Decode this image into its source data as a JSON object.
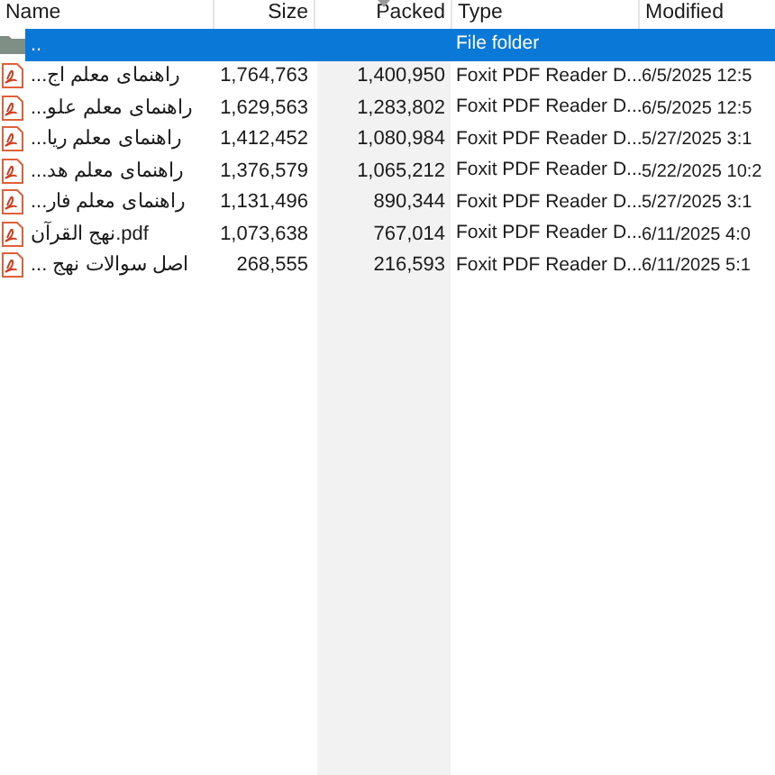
{
  "columns": [
    {
      "label": "Name",
      "sorted": false
    },
    {
      "label": "Size",
      "sorted": false
    },
    {
      "label": "Packed",
      "sorted": true
    },
    {
      "label": "Type",
      "sorted": false
    },
    {
      "label": "Modified",
      "sorted": false
    }
  ],
  "rows": [
    {
      "kind": "folder",
      "selected": true,
      "name": "..",
      "size": "",
      "packed": "",
      "type": "File folder",
      "modified": ""
    },
    {
      "kind": "pdf",
      "selected": false,
      "name": "...راهنمای معلم اج",
      "size": "1,764,763",
      "packed": "1,400,950",
      "type": "Foxit PDF Reader D...",
      "modified": "6/5/2025 12:5"
    },
    {
      "kind": "pdf",
      "selected": false,
      "name": "...راهنمای معلم علو",
      "size": "1,629,563",
      "packed": "1,283,802",
      "type": "Foxit PDF Reader D...",
      "modified": "6/5/2025 12:5"
    },
    {
      "kind": "pdf",
      "selected": false,
      "name": "...راهنمای معلم ریا",
      "size": "1,412,452",
      "packed": "1,080,984",
      "type": "Foxit PDF Reader D...",
      "modified": "5/27/2025 3:1"
    },
    {
      "kind": "pdf",
      "selected": false,
      "name": "...راهنمای معلم هد",
      "size": "1,376,579",
      "packed": "1,065,212",
      "type": "Foxit PDF Reader D...",
      "modified": "5/22/2025 10:2"
    },
    {
      "kind": "pdf",
      "selected": false,
      "name": "...راهنمای معلم فار",
      "size": "1,131,496",
      "packed": "890,344",
      "type": "Foxit PDF Reader D...",
      "modified": "5/27/2025 3:1"
    },
    {
      "kind": "pdf",
      "selected": false,
      "name": "نهج القرآن.pdf",
      "size": "1,073,638",
      "packed": "767,014",
      "type": "Foxit PDF Reader D...",
      "modified": "6/11/2025 4:0"
    },
    {
      "kind": "pdf",
      "selected": false,
      "name": "... اصل سوالات نهج",
      "size": "268,555",
      "packed": "216,593",
      "type": "Foxit PDF Reader D...",
      "modified": "6/11/2025 5:1"
    }
  ]
}
